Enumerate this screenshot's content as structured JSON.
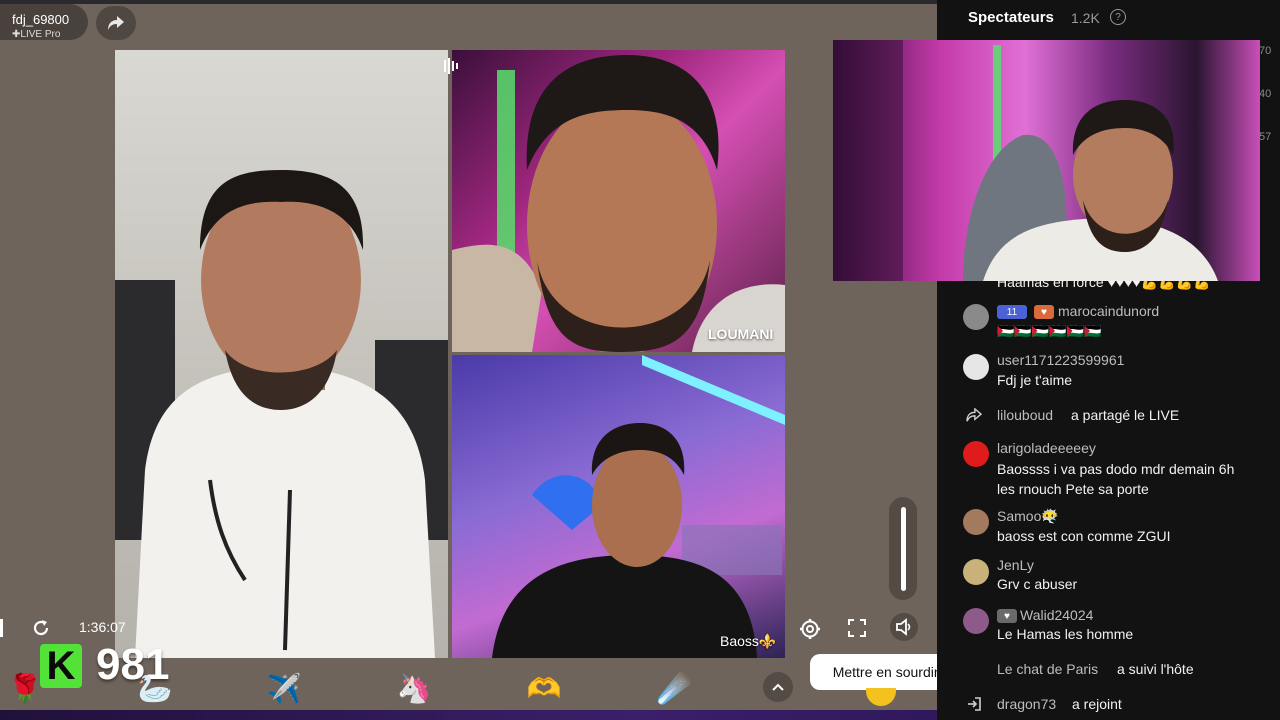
{
  "host": {
    "name": "fdj_69800",
    "subtitle": "✚LIVE Pro"
  },
  "videos": {
    "top_right_label": "LOUMANI",
    "bottom_right_label": "Baoss⚜️"
  },
  "controls": {
    "time": "1:36:07",
    "tooltip": "Mettre en sourdine (M)",
    "volume_level": 1.0
  },
  "score": {
    "badge": "K",
    "value": "981"
  },
  "gifts": [
    "rose",
    "swan",
    "jet",
    "unicorn",
    "heart-hands",
    "comet"
  ],
  "panel": {
    "title": "Spectateurs",
    "count": "1.2K",
    "side_numbers": [
      "70",
      "40",
      "57"
    ]
  },
  "chat": [
    {
      "user": "",
      "message": "Haamas en force ♥♥♥♥💪💪💪💪",
      "kind": "msg"
    },
    {
      "user": "marocaindunord",
      "level": "11",
      "message": "🇵🇸🇵🇸🇵🇸🇵🇸🇵🇸🇵🇸",
      "kind": "msg"
    },
    {
      "user": "user1171223599961",
      "message": "Fdj je t'aime",
      "kind": "msg"
    },
    {
      "user": "lilouboud",
      "message": "a partagé le LIVE",
      "kind": "event"
    },
    {
      "user": "larigoladeeeeey",
      "message": "Baossss i va pas dodo mdr demain 6h les rnouch Pete sa porte",
      "kind": "msg"
    },
    {
      "user": "Samoo😶‍🌫️",
      "message": "baoss est con comme ZGUI",
      "kind": "msg"
    },
    {
      "user": "JenLy",
      "message": "Grv c abuser",
      "kind": "msg"
    },
    {
      "user": "Walid24024",
      "message": "Le Hamas les homme",
      "kind": "msg"
    },
    {
      "user": "Le chat de Paris",
      "message": "a suivi l'hôte",
      "kind": "event"
    },
    {
      "user": "dragon73",
      "message": "a rejoint",
      "kind": "event"
    }
  ],
  "colors": {
    "panel_bg": "#121212",
    "score_green": "#53e237",
    "stage_bg": "#6f645b"
  }
}
